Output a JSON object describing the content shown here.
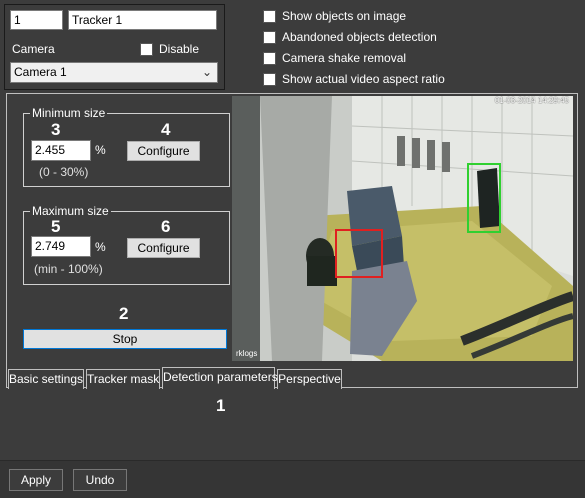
{
  "tracker": {
    "id_value": "1",
    "name_value": "Tracker 1",
    "camera_label": "Camera",
    "disable_label": "Disable",
    "camera_selected": "Camera 1"
  },
  "options": [
    {
      "label": "Show objects on image"
    },
    {
      "label": "Abandoned objects detection"
    },
    {
      "label": "Camera shake removal"
    },
    {
      "label": "Show actual video aspect ratio"
    }
  ],
  "min_size": {
    "legend": "Minimum size",
    "value": "2.455",
    "unit": "%",
    "range": "(0 - 30%)",
    "configure_label": "Configure",
    "callout_field": "3",
    "callout_button": "4"
  },
  "max_size": {
    "legend": "Maximum size",
    "value": "2.749",
    "unit": "%",
    "range": "(min - 100%)",
    "configure_label": "Configure",
    "callout_field": "5",
    "callout_button": "6"
  },
  "stop": {
    "callout": "2",
    "label": "Stop"
  },
  "tabs": [
    {
      "label": "Basic settings"
    },
    {
      "label": "Tracker mask"
    },
    {
      "label": "Detection parameters"
    },
    {
      "label": "Perspective"
    }
  ],
  "tabs_callout": "1",
  "footer": {
    "apply_label": "Apply",
    "undo_label": "Undo"
  },
  "video": {
    "timestamp": "01-03-2014 14:29:45",
    "watermark": "rklogs"
  }
}
